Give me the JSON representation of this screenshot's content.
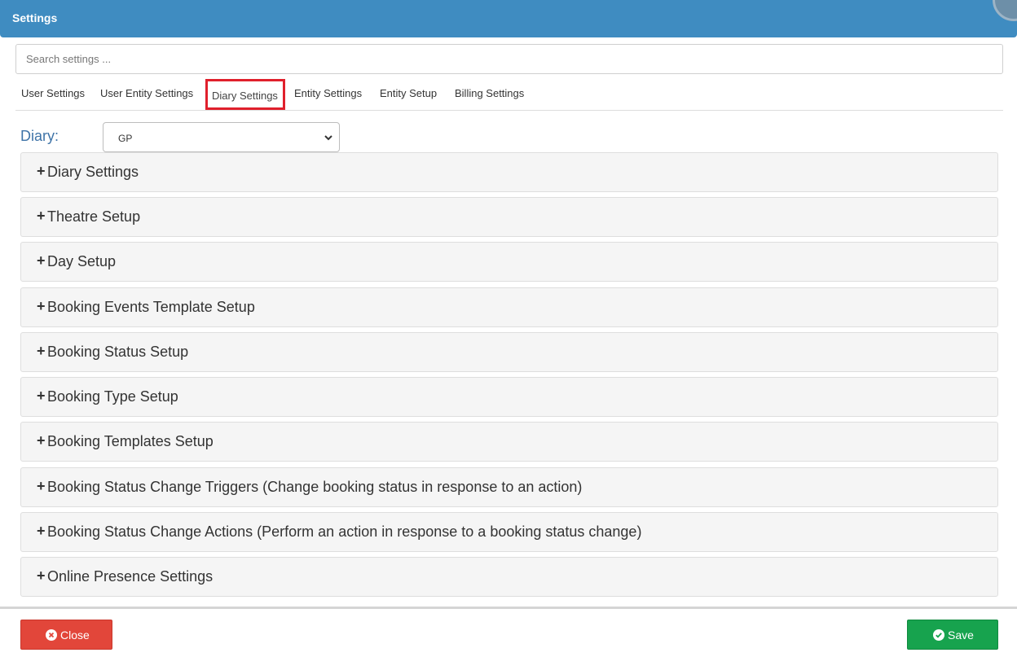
{
  "header": {
    "title": "Settings"
  },
  "search": {
    "placeholder": "Search settings ..."
  },
  "tabs": [
    {
      "label": "User Settings"
    },
    {
      "label": "User Entity Settings"
    },
    {
      "label": "Diary Settings",
      "active": true
    },
    {
      "label": "Entity Settings"
    },
    {
      "label": "Entity Setup"
    },
    {
      "label": "Billing Settings"
    }
  ],
  "diary": {
    "label": "Diary:",
    "selected": "GP"
  },
  "panels": [
    {
      "plus": "+",
      "title": "Diary Settings"
    },
    {
      "plus": "+",
      "title": "Theatre Setup"
    },
    {
      "plus": "+",
      "title": "Day Setup"
    },
    {
      "plus": "+",
      "title": "Booking Events Template Setup"
    },
    {
      "plus": "+",
      "title": "Booking Status Setup"
    },
    {
      "plus": "+",
      "title": "Booking Type Setup"
    },
    {
      "plus": "+",
      "title": "Booking Templates Setup"
    },
    {
      "plus": "+",
      "title": "Booking Status Change Triggers (Change booking status in response to an action)"
    },
    {
      "plus": "+",
      "title": "Booking Status Change Actions (Perform an action in response to a booking status change)"
    },
    {
      "plus": "+",
      "title": "Online Presence Settings"
    }
  ],
  "footer": {
    "close_label": "Close",
    "save_label": "Save"
  },
  "colors": {
    "header": "#3f8cc1",
    "active_tab_border": "#e0202c",
    "close": "#e2463a",
    "save": "#17a34e",
    "diary_label": "#3f74a8"
  },
  "icons": {
    "close": "times-circle-icon",
    "save": "check-circle-icon",
    "select": "chevron-down-icon"
  }
}
